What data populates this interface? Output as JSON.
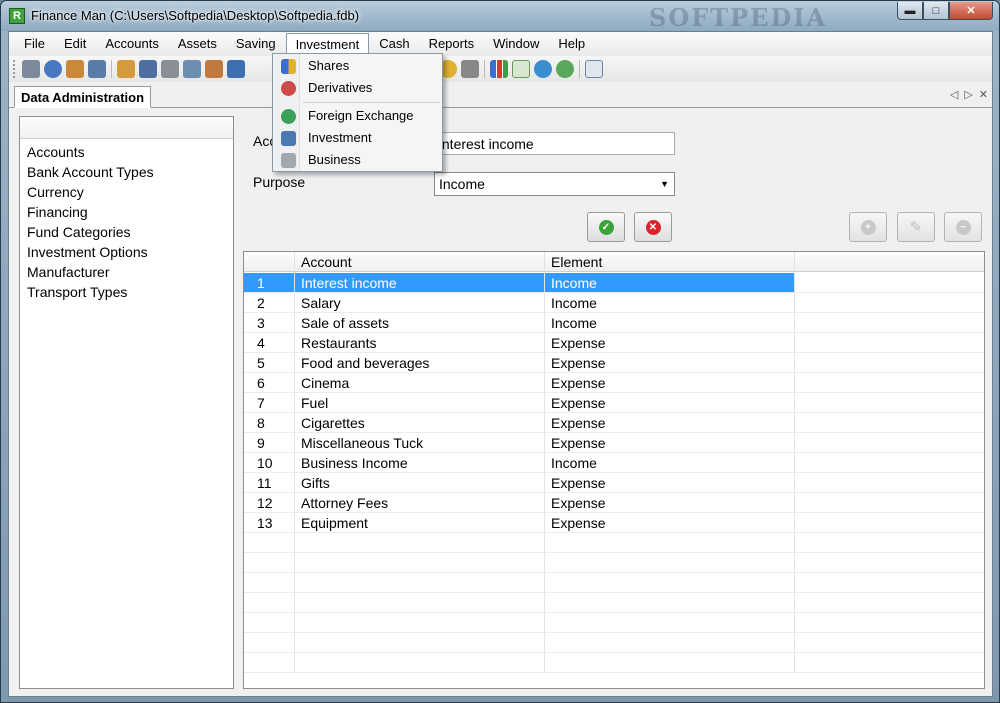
{
  "window": {
    "title": "Finance Man (C:\\Users\\Softpedia\\Desktop\\Softpedia.fdb)",
    "app_icon_letter": "R",
    "watermark": "SOFTPEDIA"
  },
  "menubar": [
    "File",
    "Edit",
    "Accounts",
    "Assets",
    "Saving",
    "Investment",
    "Cash",
    "Reports",
    "Window",
    "Help"
  ],
  "investment_menu": {
    "items": [
      {
        "label": "Shares",
        "icon": "chart-icon"
      },
      {
        "label": "Derivatives",
        "icon": "derivatives-icon"
      },
      {
        "label": "Foreign Exchange",
        "icon": "globe-icon"
      },
      {
        "label": "Investment",
        "icon": "investment-icon"
      },
      {
        "label": "Business",
        "icon": "briefcase-icon"
      }
    ]
  },
  "tab": {
    "label": "Data Administration"
  },
  "sidebar": {
    "items": [
      "Accounts",
      "Bank Account Types",
      "Currency",
      "Financing",
      "Fund Categories",
      "Investment Options",
      "Manufacturer",
      "Transport Types"
    ]
  },
  "form": {
    "account_label": "Acc",
    "account_value": "Interest income",
    "purpose_label": "Purpose",
    "purpose_value": "Income"
  },
  "grid": {
    "headers": {
      "account": "Account",
      "element": "Element"
    },
    "rows": [
      {
        "num": "1",
        "account": "Interest income",
        "element": "Income"
      },
      {
        "num": "2",
        "account": "Salary",
        "element": "Income"
      },
      {
        "num": "3",
        "account": "Sale of assets",
        "element": "Income"
      },
      {
        "num": "4",
        "account": "Restaurants",
        "element": "Expense"
      },
      {
        "num": "5",
        "account": "Food and beverages",
        "element": "Expense"
      },
      {
        "num": "6",
        "account": "Cinema",
        "element": "Expense"
      },
      {
        "num": "7",
        "account": "Fuel",
        "element": "Expense"
      },
      {
        "num": "8",
        "account": "Cigarettes",
        "element": "Expense"
      },
      {
        "num": "9",
        "account": "Miscellaneous Tuck",
        "element": "Expense"
      },
      {
        "num": "10",
        "account": "Business Income",
        "element": "Income"
      },
      {
        "num": "11",
        "account": "Gifts",
        "element": "Expense"
      },
      {
        "num": "12",
        "account": "Attorney Fees",
        "element": "Expense"
      },
      {
        "num": "13",
        "account": "Equipment",
        "element": "Expense"
      }
    ]
  },
  "colors": {
    "selection": "#3399ff",
    "confirm": "#3aa33a",
    "cancel": "#d9232d"
  }
}
